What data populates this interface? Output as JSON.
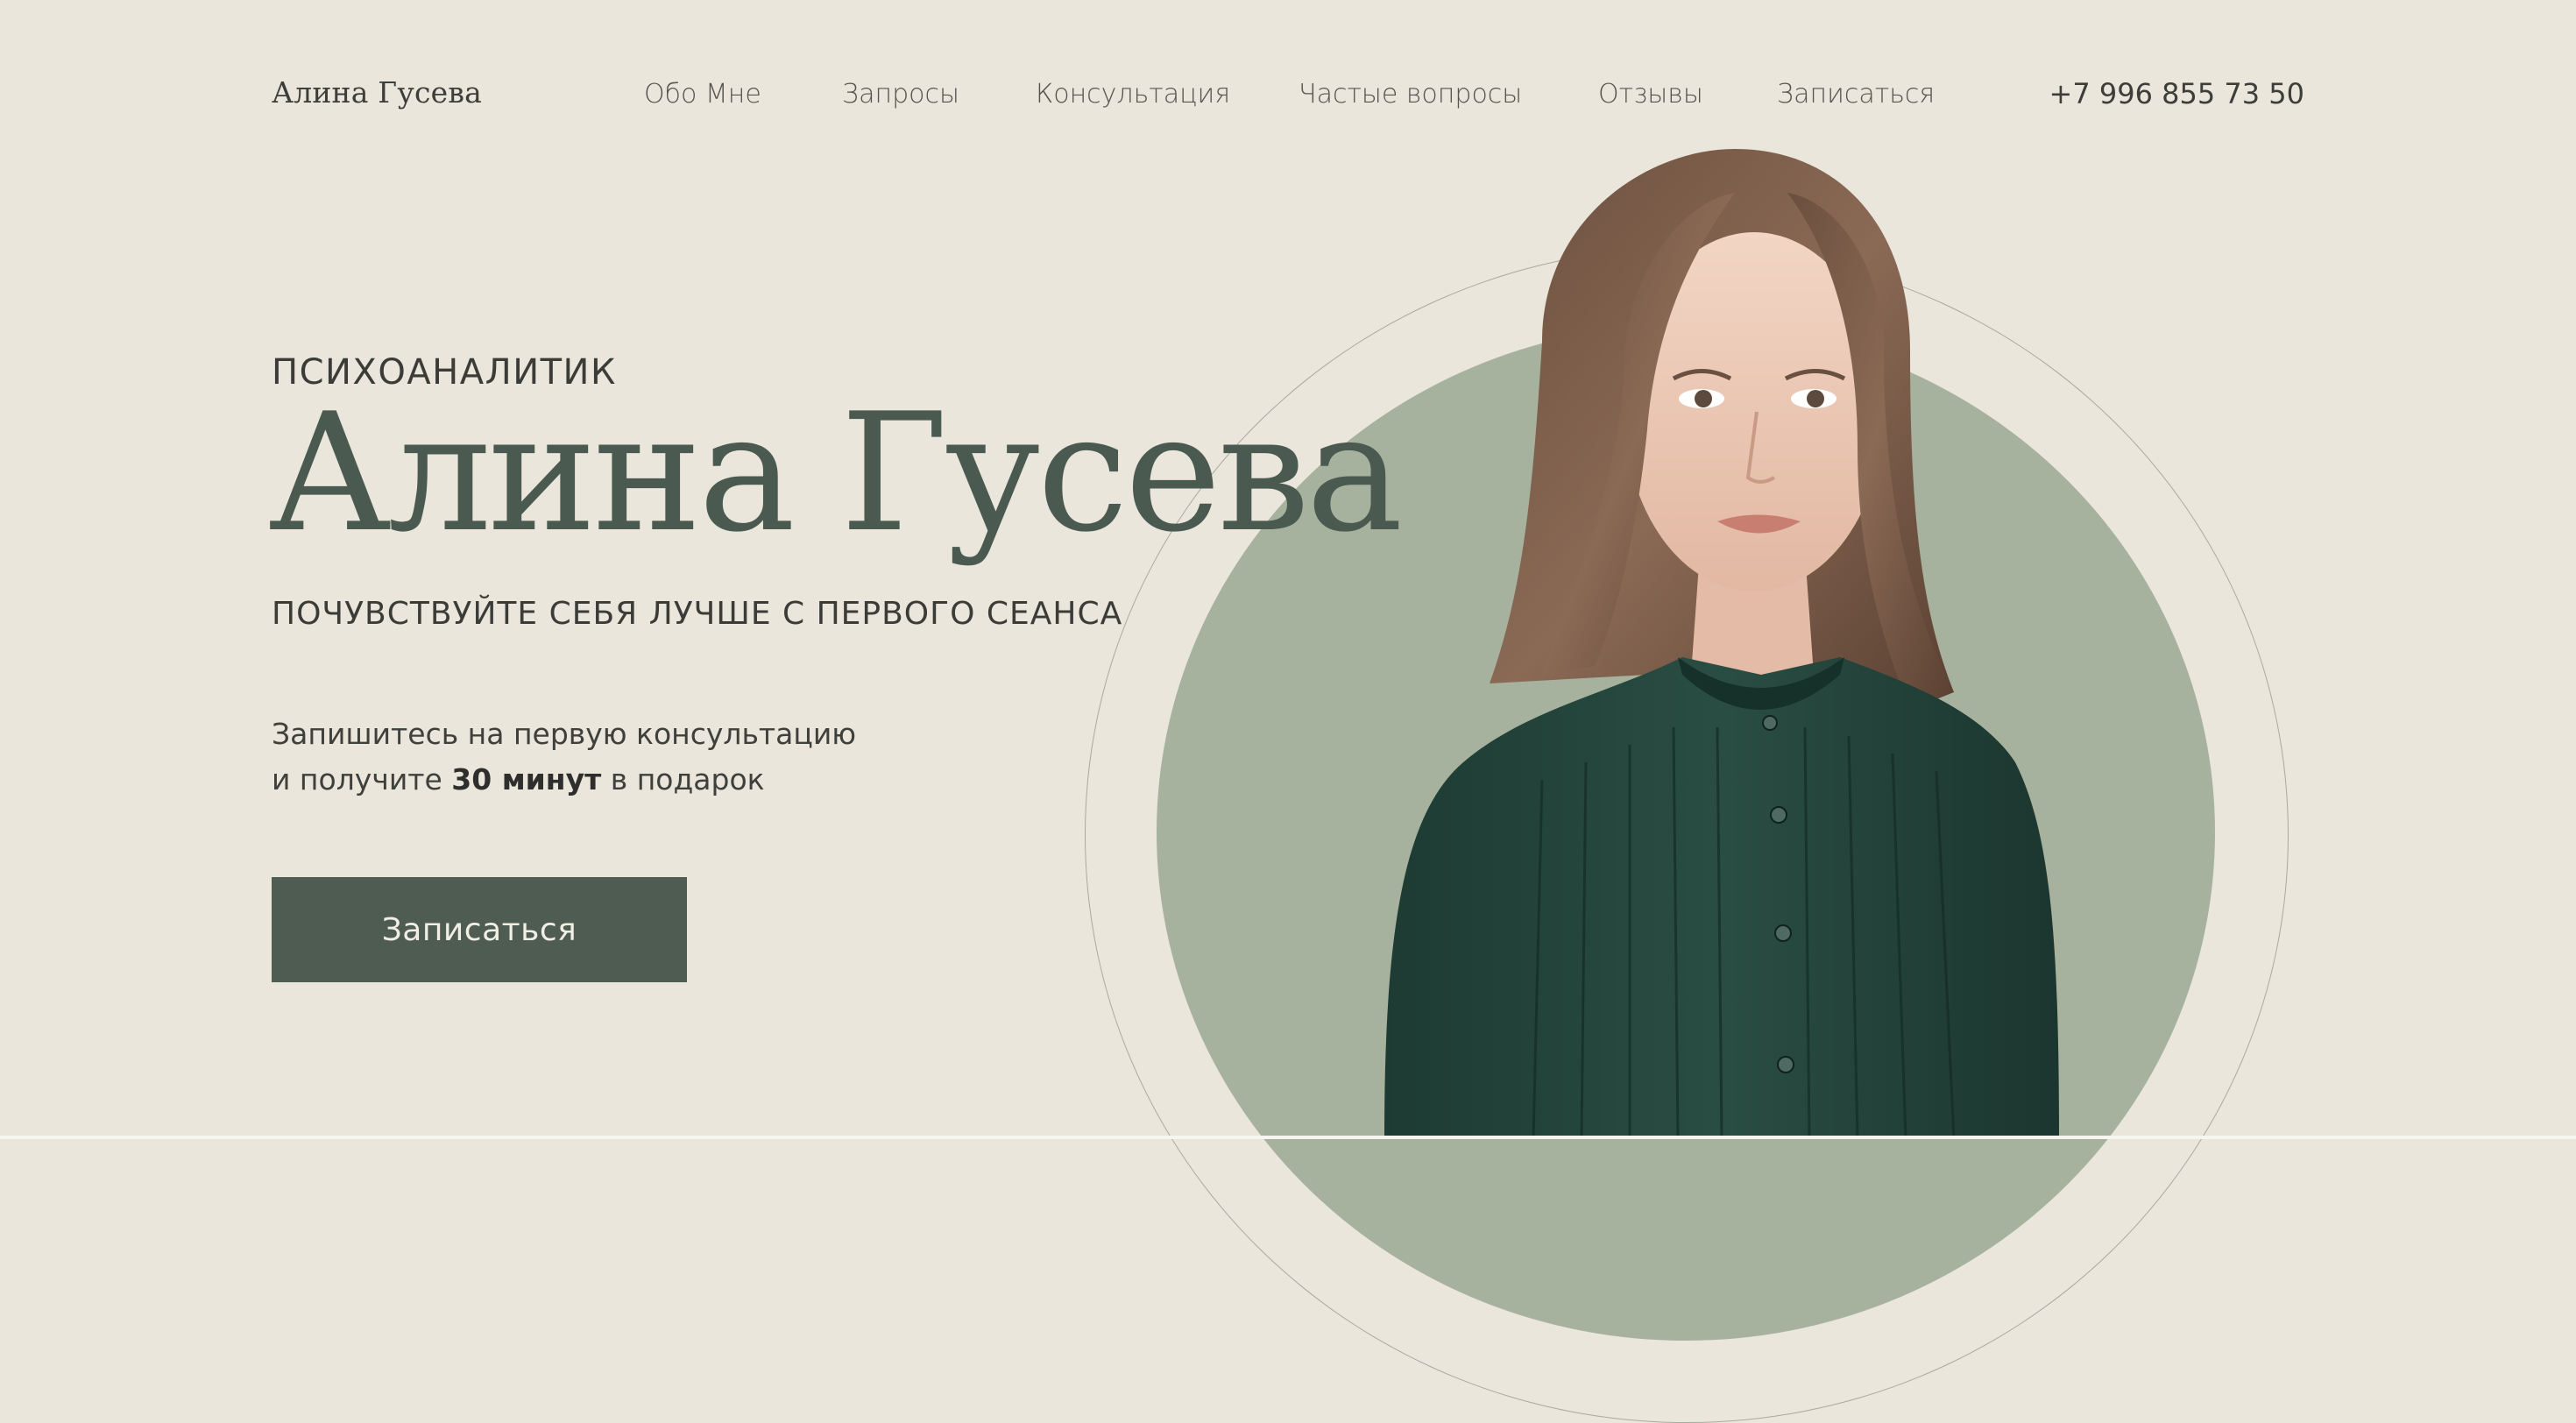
{
  "brand": "Алина Гусева",
  "nav": [
    {
      "label": "Обо Мне"
    },
    {
      "label": "Запросы"
    },
    {
      "label": "Консультация"
    },
    {
      "label": "Частые вопросы"
    },
    {
      "label": "Отзывы"
    },
    {
      "label": "Записаться"
    }
  ],
  "phone": "+7 996 855 73 50",
  "hero": {
    "subtitle": "ПСИХОАНАЛИТИК",
    "name": "Алина Гусева",
    "tagline": "ПОЧУВСТВУЙТЕ СЕБЯ ЛУЧШЕ С ПЕРВОГО СЕАНСА",
    "offer_line1": "Запишитесь на первую консультацию",
    "offer_line2_prefix": "и получите",
    "offer_line2_bold": "30 минут",
    "offer_line2_suffix": "в подарок",
    "cta_label": "Записаться"
  },
  "colors": {
    "background": "#EAE6DC",
    "accent_dark_green": "#4F5C52",
    "sage_circle": "#A6B29D",
    "heading_green": "#4A5A50"
  }
}
